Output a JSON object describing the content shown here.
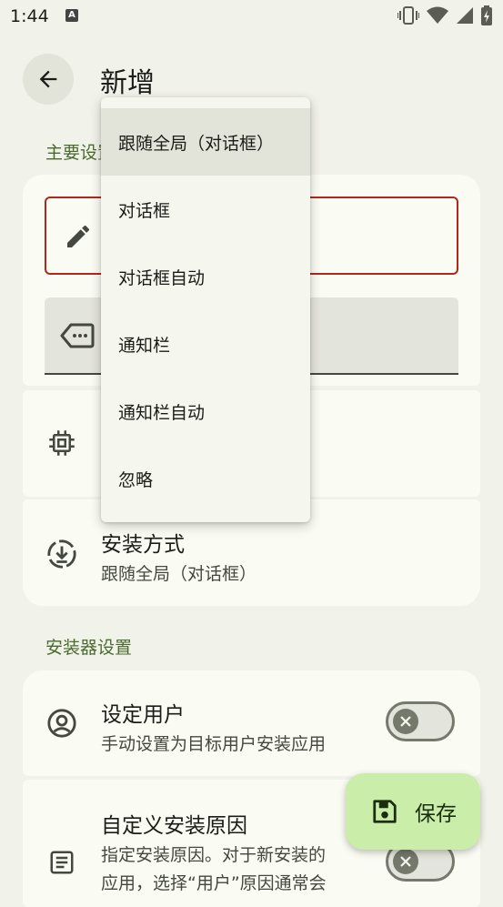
{
  "status_bar": {
    "time": "1:44",
    "a_badge": "A"
  },
  "header": {
    "title": "新增"
  },
  "sections": {
    "main_label": "主要设置",
    "installer_label": "安装器设置"
  },
  "install_method": {
    "title": "安装方式",
    "value": "跟随全局（对话框）"
  },
  "set_user": {
    "title": "设定用户",
    "subtitle": "手动设置为目标用户安装应用"
  },
  "custom_reason": {
    "title": "自定义安装原因",
    "subtitle_line1": "指定安装原因。对于新安装的",
    "subtitle_line2": "应用，选择“用户”原因通常会"
  },
  "menu": {
    "items": [
      {
        "label": "跟随全局（对话框）",
        "selected": true
      },
      {
        "label": "对话框"
      },
      {
        "label": "对话框自动"
      },
      {
        "label": "通知栏"
      },
      {
        "label": "通知栏自动"
      },
      {
        "label": "忽略"
      }
    ]
  },
  "fab": {
    "label": "保存"
  },
  "colors": {
    "accent_green": "#4b6a2e",
    "fab_bg": "#cbedaa",
    "error_red": "#b3261e"
  }
}
